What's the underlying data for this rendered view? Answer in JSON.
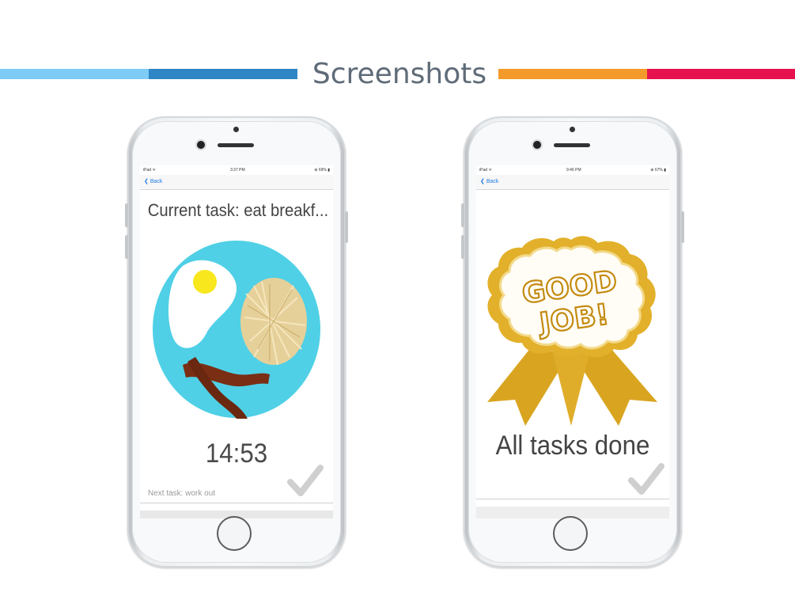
{
  "header": {
    "title": "Screenshots",
    "colors": [
      "#7ecbf5",
      "#2e86c4",
      "#f39a2b",
      "#e8114f"
    ]
  },
  "phone_left": {
    "status": {
      "carrier": "iPad ᯤ",
      "time": "3:37 PM",
      "battery": "⊕ 69% ▮"
    },
    "back_label": "Back",
    "task_title": "Current task: eat breakf...",
    "image": "breakfast-plate-illustration",
    "timer": "14:53",
    "next_task": "Next task: work out",
    "check_icon": "checkmark-icon"
  },
  "phone_right": {
    "status": {
      "carrier": "iPad ᯤ",
      "time": "9:46 PM",
      "battery": "⊕ 67% ▮"
    },
    "back_label": "Back",
    "badge_text": [
      "GOOD",
      "JOB!"
    ],
    "done_text": "All tasks done",
    "check_icon": "checkmark-icon"
  }
}
